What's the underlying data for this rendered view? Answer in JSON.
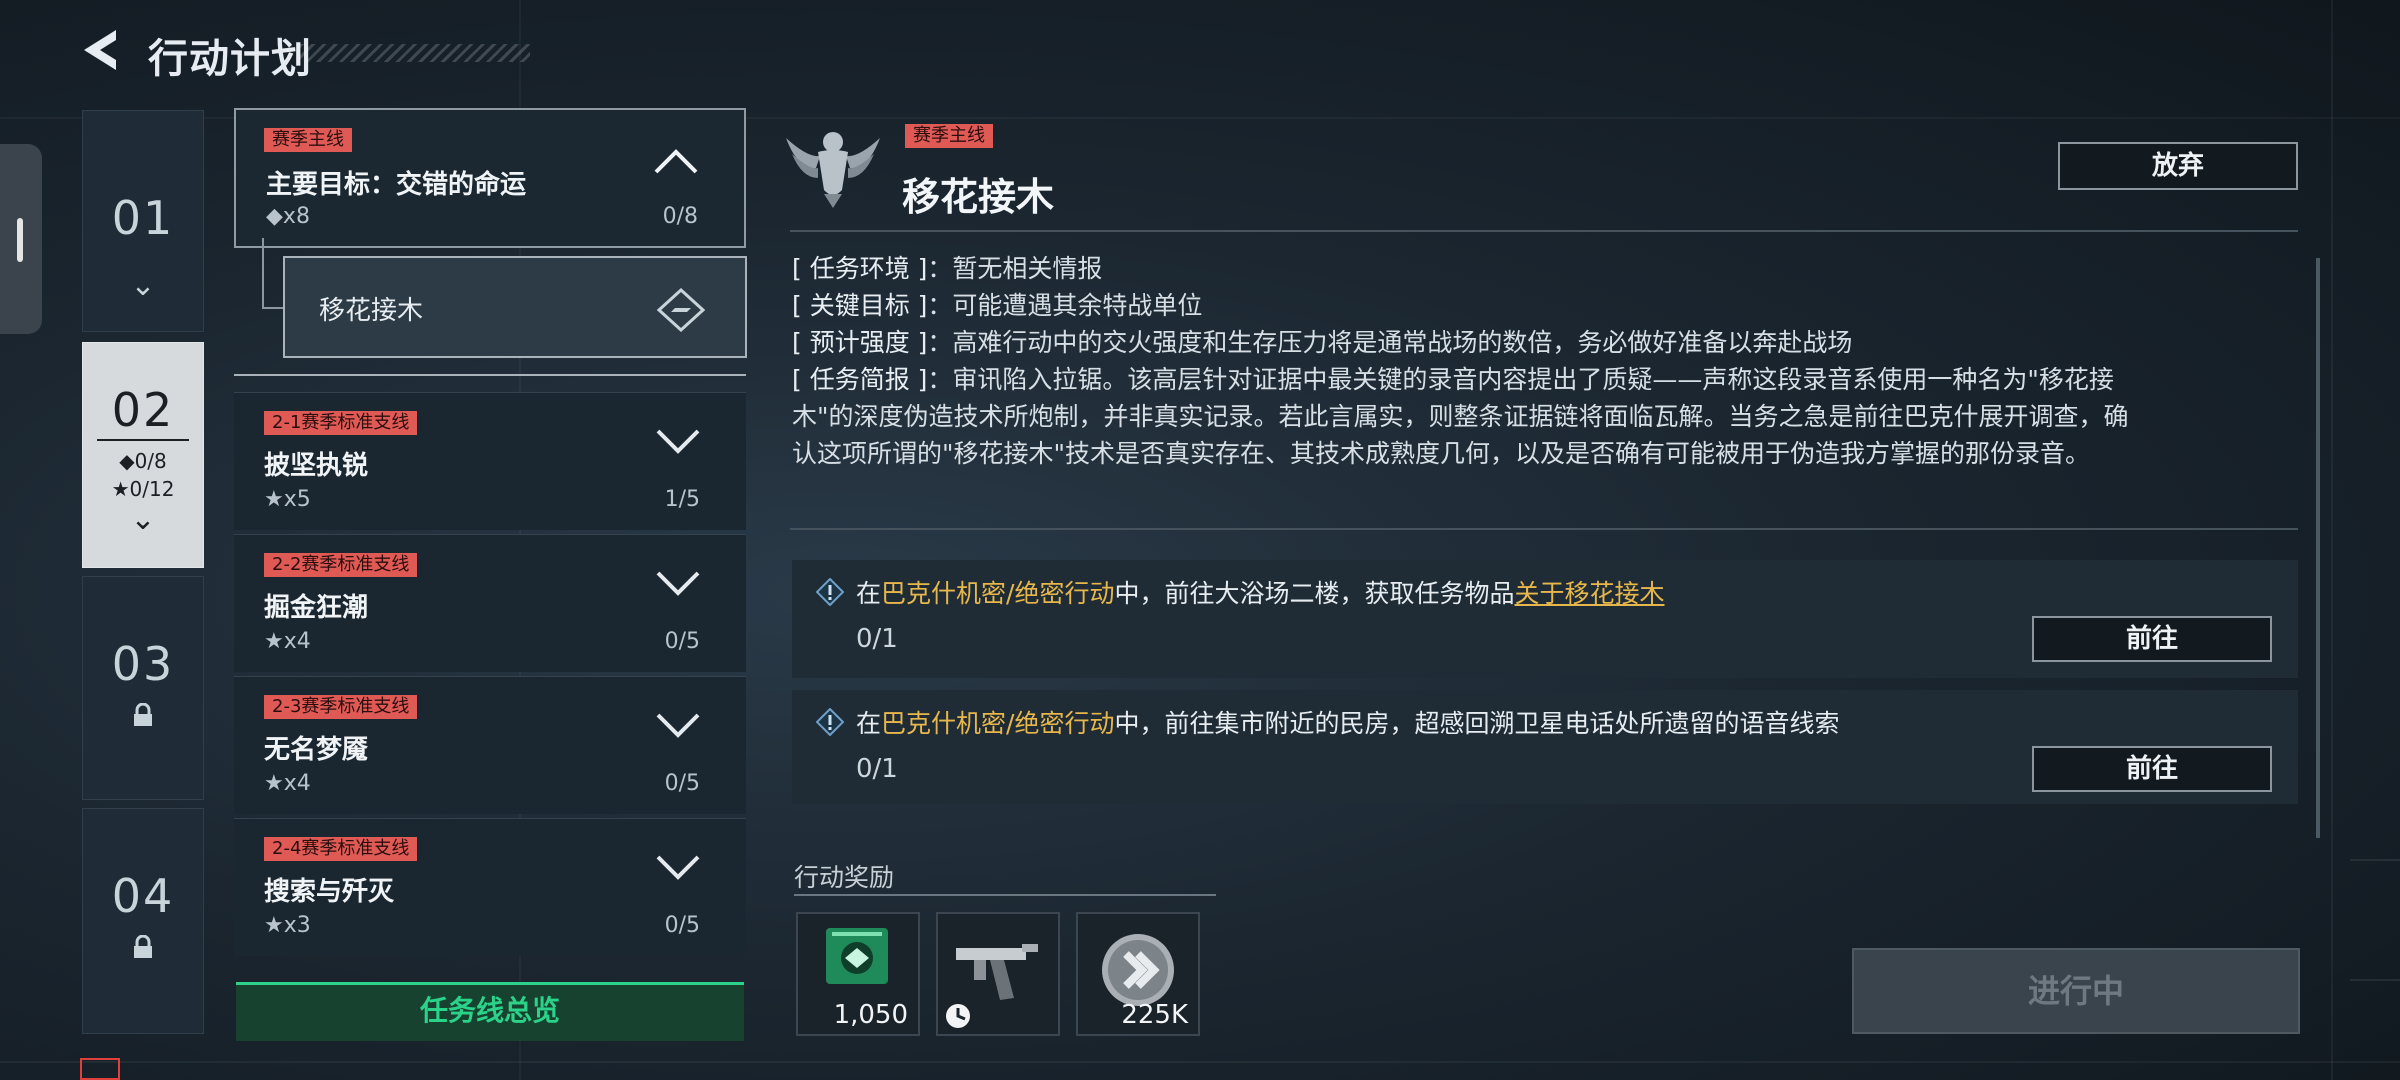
{
  "header": {
    "title": "行动计划",
    "back_icon": "back-arrow-icon"
  },
  "chapters": [
    {
      "num": "01"
    },
    {
      "num": "02",
      "stat1": "◆0/8",
      "stat2": "★0/12"
    },
    {
      "num": "03"
    },
    {
      "num": "04"
    }
  ],
  "main_task": {
    "tag": "赛季主线",
    "name": "主要目标：交错的命运",
    "count": "◆x8",
    "progress": "0/8",
    "subtask": "移花接木"
  },
  "tasks": [
    {
      "tag": "2-1赛季标准支线",
      "name": "披坚执锐",
      "count": "★x5",
      "progress": "1/5"
    },
    {
      "tag": "2-2赛季标准支线",
      "name": "掘金狂潮",
      "count": "★x4",
      "progress": "0/5"
    },
    {
      "tag": "2-3赛季标准支线",
      "name": "无名梦魇",
      "count": "★x4",
      "progress": "0/5"
    },
    {
      "tag": "2-4赛季标准支线",
      "name": "搜索与歼灭",
      "count": "★x3",
      "progress": "0/5"
    }
  ],
  "overview_button": "任务线总览",
  "detail": {
    "tag": "赛季主线",
    "title": "移花接木",
    "abandon": "放弃",
    "info": [
      {
        "key": "[ 任务环境 ]",
        "value": "：暂无相关情报"
      },
      {
        "key": "[ 关键目标 ]",
        "value": "：可能遭遇其余特战单位"
      },
      {
        "key": "[ 预计强度 ]",
        "value": "：高难行动中的交火强度和生存压力将是通常战场的数倍，务必做好准备以奔赴战场"
      }
    ],
    "brief_key": "[ 任务简报 ]",
    "brief_line1": "：审讯陷入拉锯。该高层针对证据中最关键的录音内容提出了质疑——声称这段录音系使用一种名为\"移花接",
    "brief_line2": "木\"的深度伪造技术所炮制，并非真实记录。若此言属实，则整条证据链将面临瓦解。当务之急是前往巴克什展开调查，确",
    "brief_line3": "认这项所谓的\"移花接木\"技术是否真实存在、其技术成熟度几何，以及是否确有可能被用于伪造我方掌握的那份录音。"
  },
  "objectives": [
    {
      "pre": "在",
      "place": "巴克什机密/绝密行动",
      "mid": "中，前往大浴场二楼，获取任务物品",
      "link": "关于移花接木",
      "progress": "0/1",
      "button": "前往"
    },
    {
      "pre": "在",
      "place": "巴克什机密/绝密行动",
      "mid": "中，前往集市附近的民房，超感回溯卫星电话处所遗留的语音线索",
      "link": "",
      "progress": "0/1",
      "button": "前往"
    }
  ],
  "rewards": {
    "label": "行动奖励",
    "items": [
      {
        "icon": "green-badge-icon",
        "amount": "1,050"
      },
      {
        "icon": "weapon-blueprint-icon",
        "amount": ""
      },
      {
        "icon": "coin-icon",
        "amount": "225K"
      }
    ]
  },
  "status_button": "进行中",
  "colors": {
    "accent_red": "#e05a55",
    "gold": "#e8b74c",
    "green": "#2bd38a"
  }
}
